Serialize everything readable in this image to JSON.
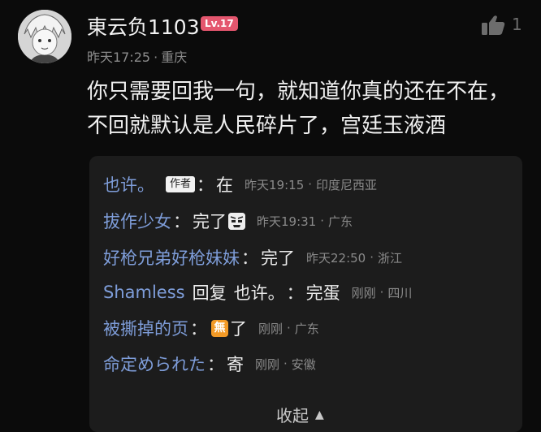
{
  "comment": {
    "user": {
      "name": "東云负1103",
      "level": "Lv.17"
    },
    "time": "昨天17:25",
    "location": "重庆",
    "likes": "1",
    "text": "你只需要回我一句，就知道你真的还在不在，不回就默认是人民碎片了，宫廷玉液酒"
  },
  "replies": [
    {
      "author": "也许。",
      "badge": "作者",
      "body": "在",
      "time": "昨天19:15",
      "place": "印度尼西亚"
    },
    {
      "author": "拔作少女",
      "body": "完了",
      "emoji": "face-emoji",
      "time": "昨天19:31",
      "place": "广东"
    },
    {
      "author": "好枪兄弟好枪妹妹",
      "body": "完了",
      "time": "昨天22:50",
      "place": "浙江"
    },
    {
      "author": "Shamless",
      "reply_word": "回复",
      "target": "也许。",
      "body": "完蛋",
      "time": "刚刚",
      "place": "四川"
    },
    {
      "author": "被撕掉的页",
      "emoji_text": "無",
      "body": "了",
      "time": "刚刚",
      "place": "广东"
    },
    {
      "author": "命定められた",
      "body": "寄",
      "time": "刚刚",
      "place": "安徽"
    }
  ],
  "collapse_label": "收起",
  "icons": {
    "like": "thumbs-up-icon",
    "collapse": "chevron-up-icon"
  },
  "colors": {
    "background": "#0b0b0b",
    "reply_panel": "#1c1c1c",
    "author_name": "#7e9dd9",
    "level_badge": "#e4566e",
    "meta_text": "#8a8a8a"
  }
}
